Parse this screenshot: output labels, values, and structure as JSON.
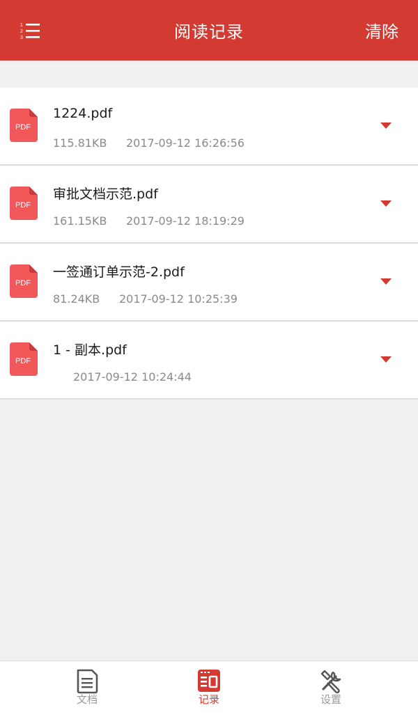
{
  "header": {
    "title": "阅读记录",
    "clear_label": "清除",
    "menu_icon": "numbered-list-icon"
  },
  "files": [
    {
      "name": "1224.pdf",
      "size": "115.81KB",
      "time": "2017-09-12 16:26:56",
      "icon_label": "PDF"
    },
    {
      "name": "审批文档示范.pdf",
      "size": "161.15KB",
      "time": "2017-09-12 18:19:29",
      "icon_label": "PDF"
    },
    {
      "name": "一签通订单示范-2.pdf",
      "size": "81.24KB",
      "time": "2017-09-12 10:25:39",
      "icon_label": "PDF"
    },
    {
      "name": "1 - 副本.pdf",
      "size": "",
      "time": "2017-09-12 10:24:44",
      "icon_label": "PDF"
    }
  ],
  "tabs": [
    {
      "label": "文档",
      "icon": "document-icon",
      "active": false
    },
    {
      "label": "记录",
      "icon": "history-icon",
      "active": true
    },
    {
      "label": "设置",
      "icon": "tools-icon",
      "active": false
    }
  ],
  "colors": {
    "accent": "#d33a31",
    "pdf_icon": "#f0585a",
    "background": "#f1f1f1",
    "inactive_tab": "#9a9a9a"
  }
}
